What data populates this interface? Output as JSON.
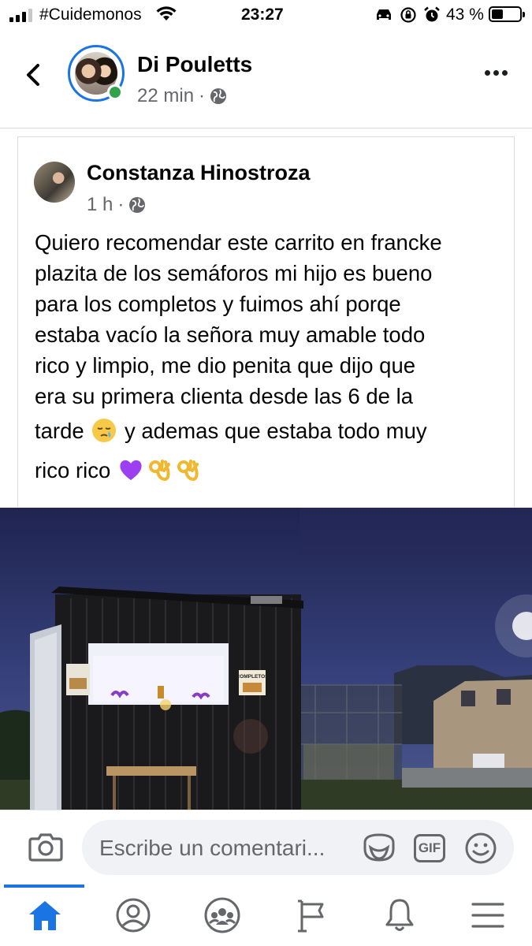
{
  "status_bar": {
    "carrier": "#Cuidemonos",
    "time": "23:27",
    "battery": "43 %",
    "battery_level": 0.43
  },
  "header": {
    "name": "Di Pouletts",
    "time": "22 min",
    "separator": "·",
    "privacy_icon": "globe-icon"
  },
  "shared_post": {
    "author": "Constanza Hinostroza",
    "time": "1 h",
    "separator": "·",
    "privacy_icon": "globe-icon",
    "lines": [
      "Quiero recomendar este carrito en francke",
      "plazita de los semáforos mi hijo es bueno",
      "para los completos y fuimos ahí porqe",
      "estaba vacío la señora muy amable todo",
      "rico y limpio, me dio penita que dijo que",
      "era su primera clienta desde las 6 de la"
    ],
    "line7_before": "tarde",
    "line7_after": "y  ademas que estaba todo muy",
    "line8": "rico rico",
    "emojis": [
      "sleepy-face-emoji",
      "purple-heart-emoji",
      "ok-hand-emoji",
      "ok-hand-emoji"
    ]
  },
  "photo": {
    "sign_left": "",
    "sign_right": "COMPLETOS"
  },
  "comment_bar": {
    "placeholder": "Escribe un comentari...",
    "gif_label": "GIF"
  },
  "nav": {
    "items": [
      "home-icon",
      "profile-icon",
      "groups-icon",
      "pages-flag-icon",
      "notifications-bell-icon",
      "menu-icon"
    ],
    "active": "home-icon"
  },
  "colors": {
    "accent": "#1b74e4",
    "online": "#31a24c",
    "secondary_text": "#65676b"
  }
}
